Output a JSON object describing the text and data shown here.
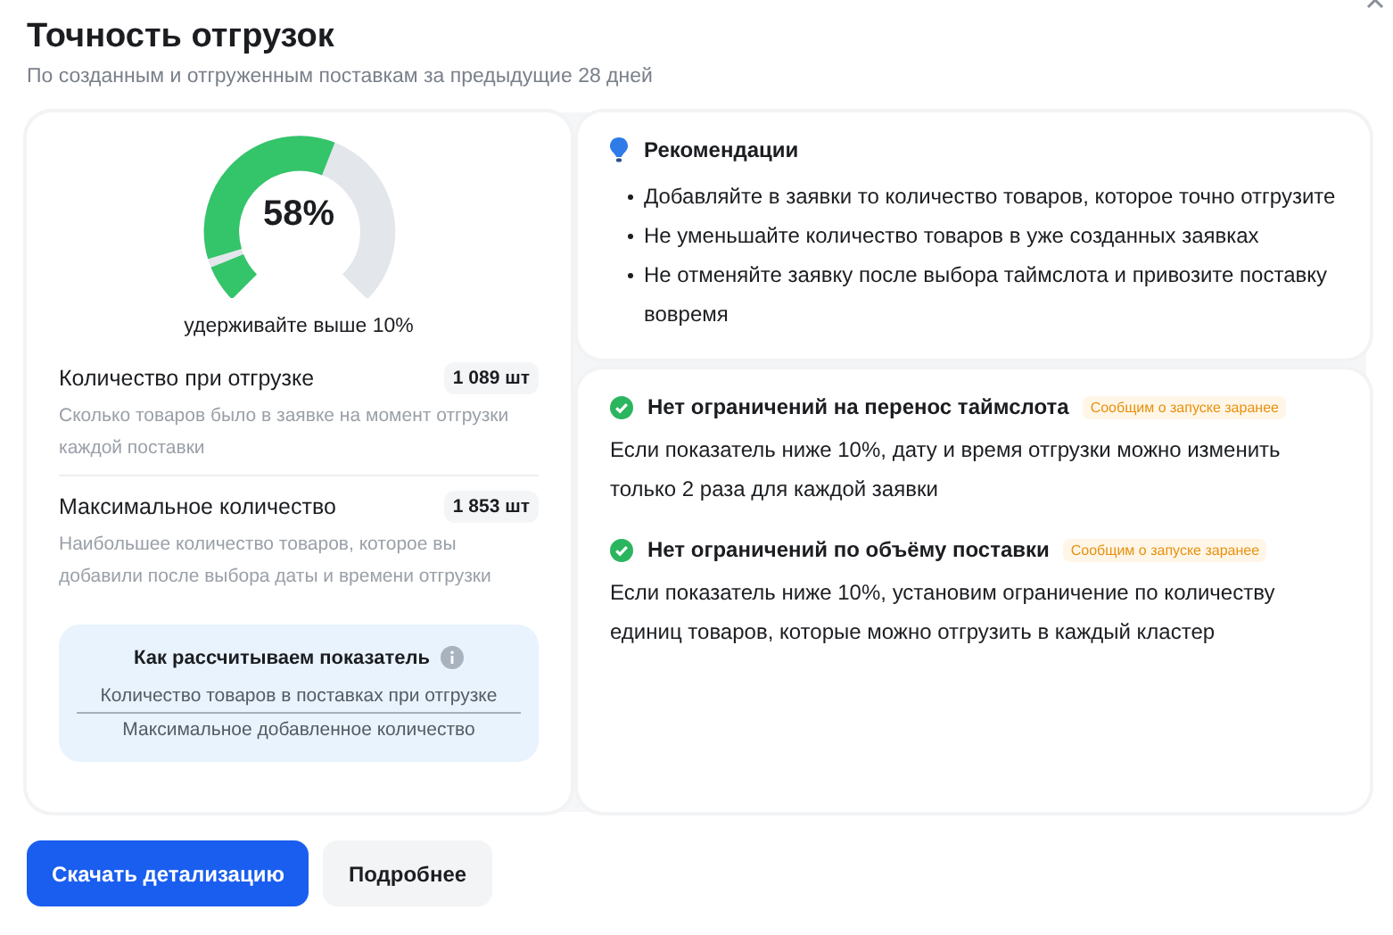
{
  "title": "Точность отгрузок",
  "subtitle": "По созданным и отгруженным поставкам за предыдущие 28 дней",
  "gauge": {
    "value": "58%",
    "caption": "удерживайте выше 10%"
  },
  "metrics": [
    {
      "label": "Количество при отгрузке",
      "value": "1 089 шт",
      "description": "Сколько товаров было в заявке на момент отгрузки каждой поставки"
    },
    {
      "label": "Максимальное количество",
      "value": "1 853 шт",
      "description": "Наибольшее количество товаров, которое вы добавили после выбора даты и времени отгрузки"
    }
  ],
  "formula": {
    "title": "Как рассчитываем показатель",
    "numerator": "Количество товаров в поставках при отгрузке",
    "denominator": "Максимальное добавленное количество"
  },
  "recommendations": {
    "title": "Рекомендации",
    "items": [
      "Добавляйте в заявки то количество товаров, которое точно отгрузите",
      "Не уменьшайте количество товаров в уже созданных заявках",
      "Не отменяйте заявку после выбора таймслота и привозите поставку вовремя"
    ]
  },
  "restrictions": [
    {
      "title": "Нет ограничений на перенос таймслота",
      "badge": "Сообщим о запуске заранее",
      "text": "Если показатель ниже 10%, дату и время отгрузки можно изменить только 2 раза для каждой заявки"
    },
    {
      "title": "Нет ограничений по объёму поставки",
      "badge": "Сообщим о запуске заранее",
      "text": "Если показатель ниже 10%, установим ограничение по количеству единиц товаров, которые можно отгрузить в каждый кластер"
    }
  ],
  "buttons": [
    {
      "label": "Скачать детализацию",
      "kind": "primary"
    },
    {
      "label": "Подробнее",
      "kind": "secondary"
    }
  ]
}
